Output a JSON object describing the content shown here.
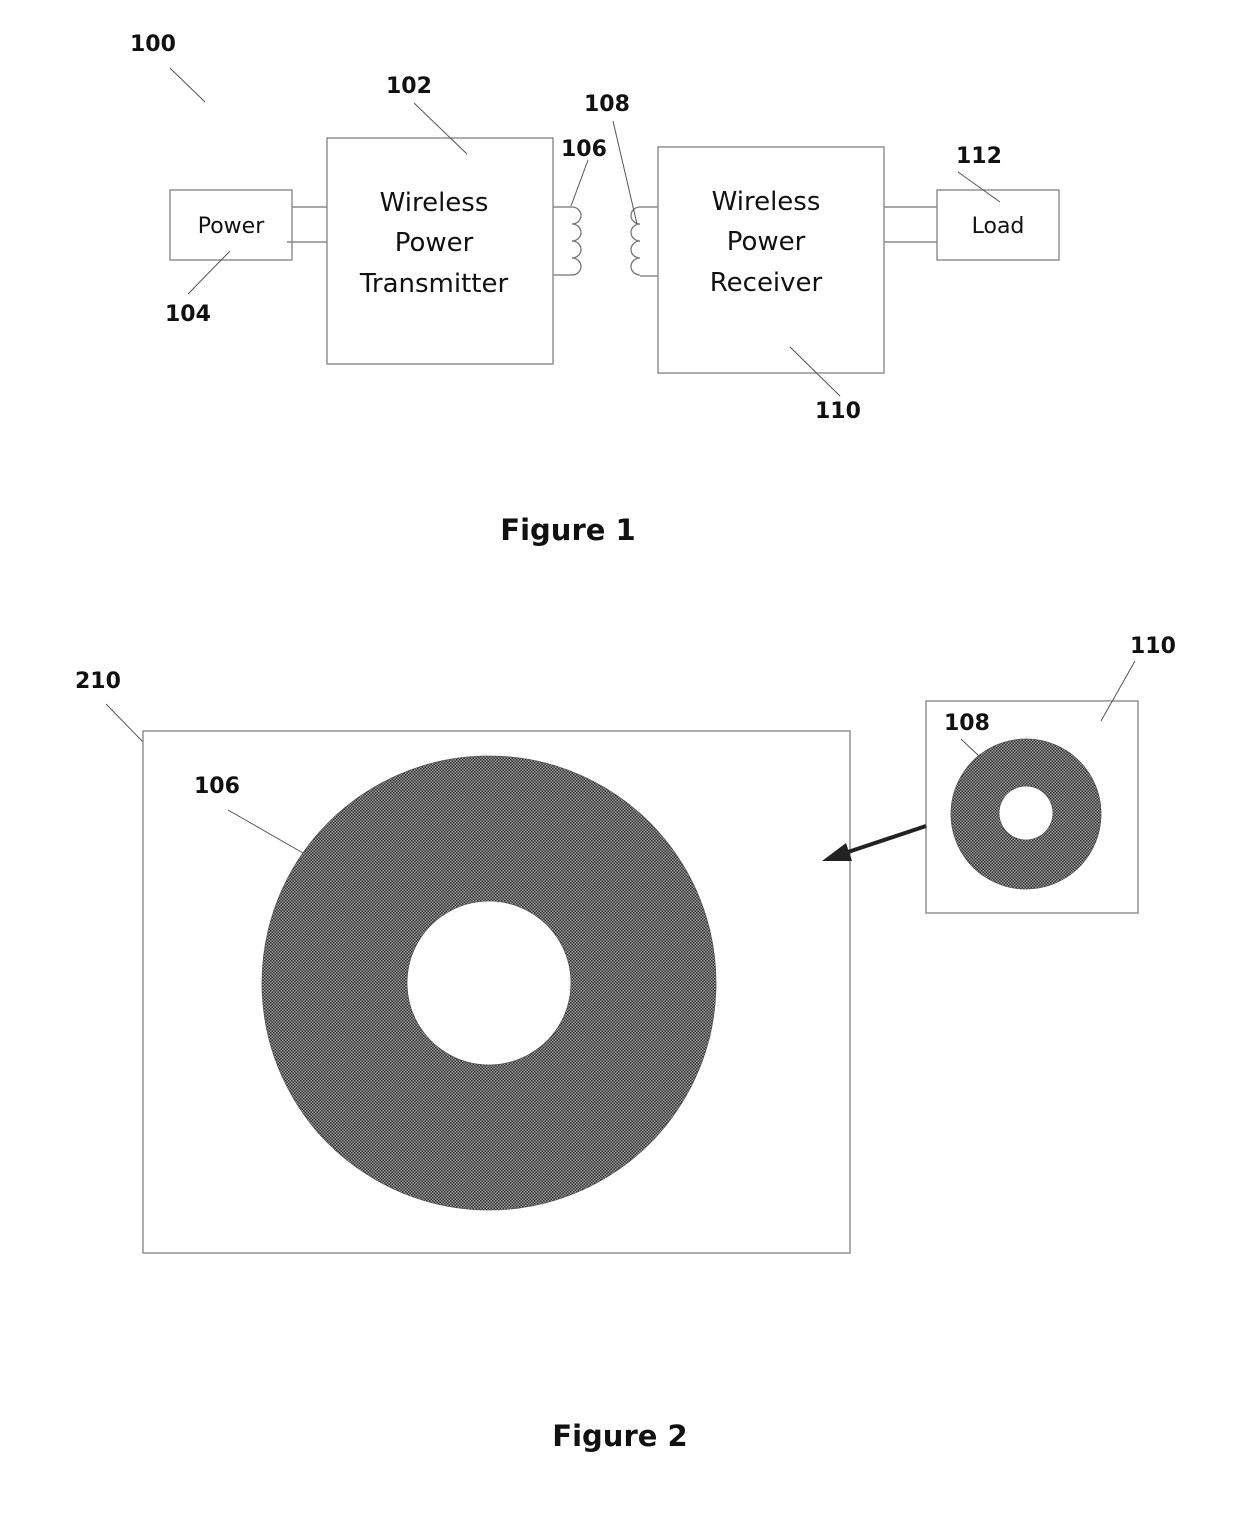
{
  "figure1": {
    "caption": "Figure 1",
    "system_ref": "100",
    "power_source": {
      "ref": "104",
      "label": "Power"
    },
    "transmitter": {
      "ref": "102",
      "lines": [
        "Wireless",
        "Power",
        "Transmitter"
      ]
    },
    "transmit_coil": {
      "ref": "106"
    },
    "receive_coil": {
      "ref": "108"
    },
    "receiver": {
      "ref": "110",
      "lines": [
        "Wireless",
        "Power",
        "Receiver"
      ]
    },
    "load": {
      "ref": "112",
      "label": "Load"
    }
  },
  "figure2": {
    "caption": "Figure 2",
    "charging_pad": {
      "ref": "210"
    },
    "transmit_coil": {
      "ref": "106"
    },
    "receiver_device": {
      "ref": "110"
    },
    "receive_coil": {
      "ref": "108"
    }
  },
  "colors": {
    "coil_fill": "#6e6e6e",
    "outline": "#8a8a8a",
    "text": "#111111"
  }
}
